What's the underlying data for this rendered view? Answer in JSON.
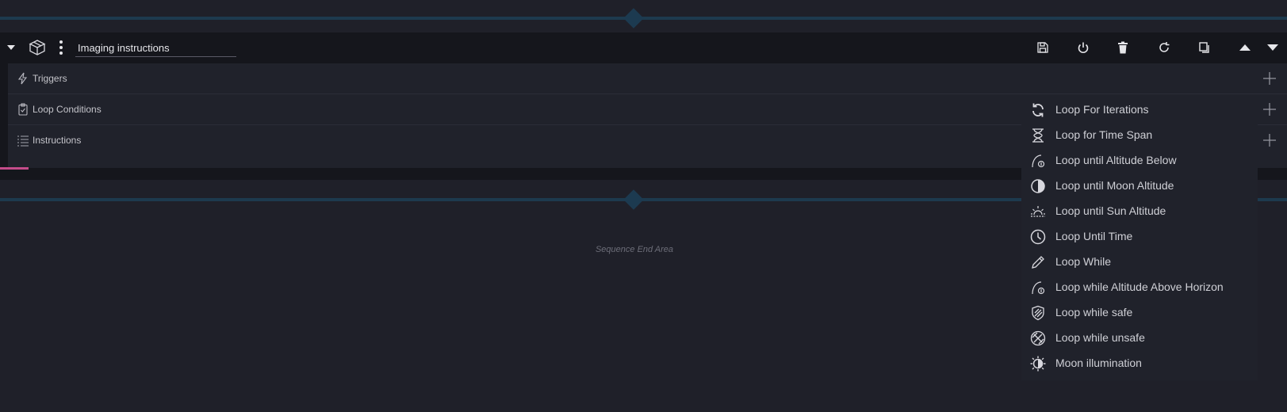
{
  "container": {
    "title": "Imaging instructions",
    "icons": [
      "chevron-down-icon",
      "box-icon",
      "kebab-icon",
      "save-icon",
      "power-icon",
      "trash-icon",
      "reset-icon",
      "copy-icon",
      "move-up-icon",
      "move-down-icon"
    ]
  },
  "sections": [
    {
      "label": "Triggers",
      "icon": "lightning-icon"
    },
    {
      "label": "Loop Conditions",
      "icon": "clipboard-check-icon"
    },
    {
      "label": "Instructions",
      "icon": "list-icon"
    }
  ],
  "end_area": {
    "label": "Sequence End Area"
  },
  "dropdown": {
    "items": [
      {
        "label": "Loop For Iterations",
        "icon": "loop-arrows-icon"
      },
      {
        "label": "Loop for Time Span",
        "icon": "hourglass-icon"
      },
      {
        "label": "Loop until Altitude Below",
        "icon": "altitude-icon"
      },
      {
        "label": "Loop until Moon Altitude",
        "icon": "moon-half-icon"
      },
      {
        "label": "Loop until Sun Altitude",
        "icon": "sunrise-icon"
      },
      {
        "label": "Loop Until Time",
        "icon": "clock-icon"
      },
      {
        "label": "Loop While",
        "icon": "pencil-icon"
      },
      {
        "label": "Loop while Altitude Above Horizon",
        "icon": "altitude-horizon-icon"
      },
      {
        "label": "Loop while safe",
        "icon": "shield-icon"
      },
      {
        "label": "Loop while unsafe",
        "icon": "unsafe-circle-icon"
      },
      {
        "label": "Moon illumination",
        "icon": "moon-illumination-icon"
      }
    ]
  },
  "colors": {
    "background": "#1f2029",
    "container": "#15161c",
    "divider": "#1d3a4e",
    "accent": "#c44c8a"
  }
}
